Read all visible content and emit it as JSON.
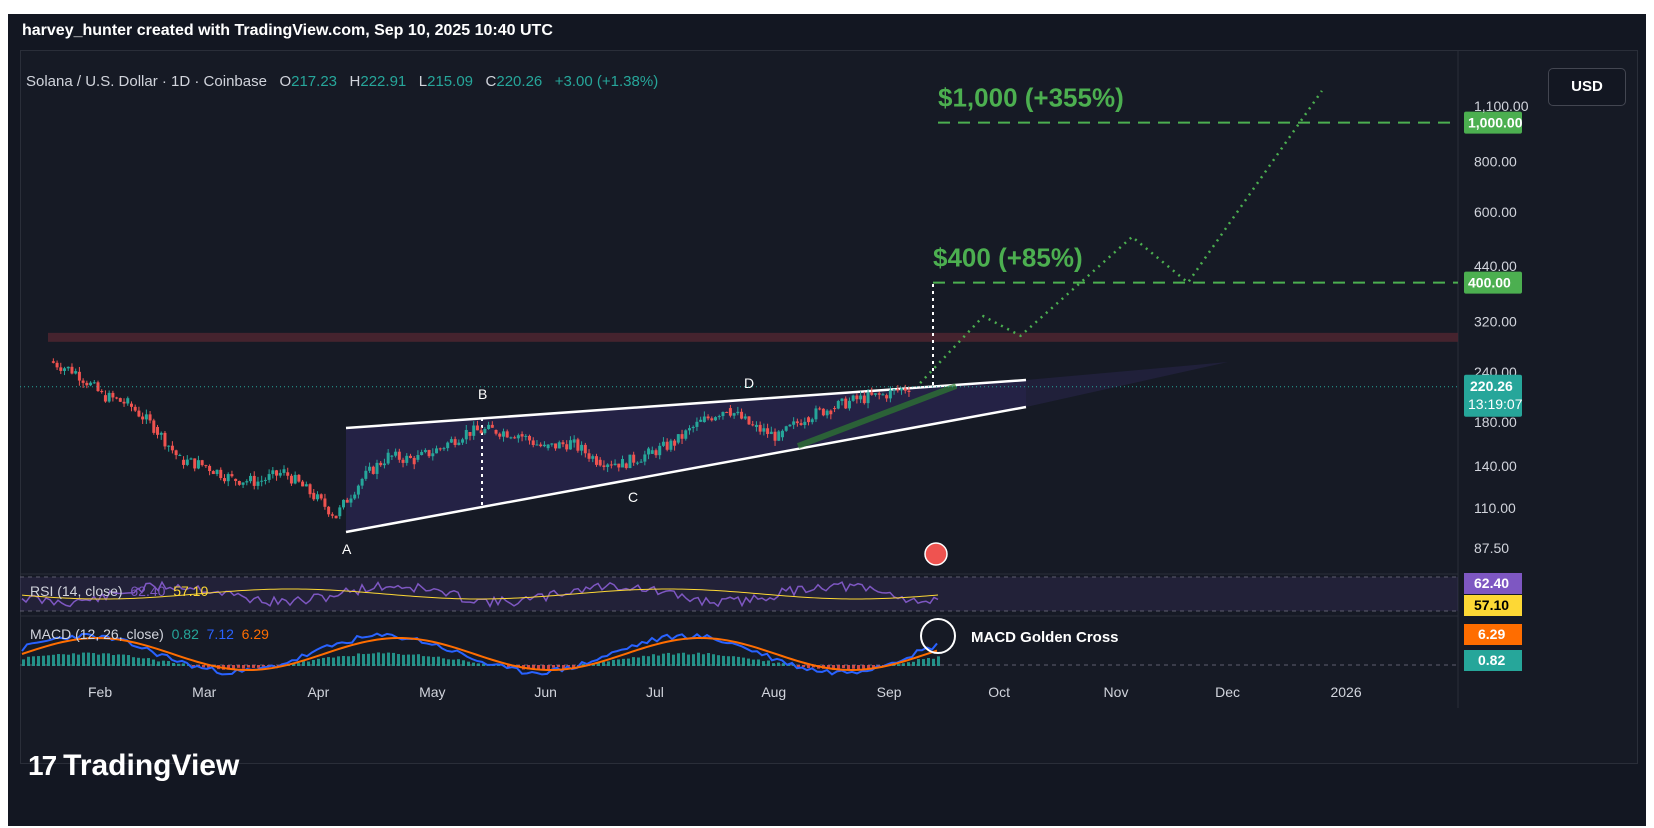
{
  "header": {
    "credit": "harvey_hunter created with TradingView.com, Sep 10, 2025 10:40 UTC"
  },
  "legend": {
    "symbol": "Solana / U.S. Dollar · 1D · Coinbase",
    "open_label": "O",
    "open": "217.23",
    "high_label": "H",
    "high": "222.91",
    "low_label": "L",
    "low": "215.09",
    "close_label": "C",
    "close": "220.26",
    "change": "+3.00 (+1.38%)"
  },
  "currency_button": "USD",
  "footer": {
    "logo_mark": "17",
    "brand": "TradingView"
  },
  "colors": {
    "up": "#26a69a",
    "down": "#ef5350",
    "target": "#4caf50",
    "pattern_fill": "#2a2550",
    "rsi": "#7e57c2",
    "macd": "#2962ff",
    "signal": "#ff6d00"
  },
  "chart_data": [
    {
      "type": "candlestick",
      "title": "Solana / U.S. Dollar · 1D · Coinbase",
      "scale": "log",
      "price_axis_ticks": [
        "1,100.00",
        "800.00",
        "600.00",
        "440.00",
        "320.00",
        "240.00",
        "180.00",
        "140.00",
        "110.00",
        "87.50"
      ],
      "price_axis_values": [
        1100,
        800,
        600,
        440,
        320,
        240,
        180,
        140,
        110,
        87.5
      ],
      "time_axis_ticks": [
        "Feb",
        "Mar",
        "Apr",
        "May",
        "Jun",
        "Jul",
        "Aug",
        "Sep",
        "Oct",
        "Nov",
        "Dec",
        "2026"
      ],
      "last_price_badge": {
        "price": "220.26",
        "countdown": "13:19:07"
      },
      "price_series": {
        "dates": [
          "Jan 20",
          "Jan 27",
          "Feb 03",
          "Feb 10",
          "Feb 17",
          "Feb 24",
          "Mar 03",
          "Mar 10",
          "Mar 17",
          "Mar 24",
          "Mar 31",
          "Apr 07",
          "Apr 14",
          "Apr 21",
          "Apr 28",
          "May 05",
          "May 12",
          "May 19",
          "May 26",
          "Jun 02",
          "Jun 09",
          "Jun 16",
          "Jun 23",
          "Jun 30",
          "Jul 07",
          "Jul 14",
          "Jul 21",
          "Jul 28",
          "Aug 04",
          "Aug 11",
          "Aug 18",
          "Aug 25",
          "Sep 01",
          "Sep 08"
        ],
        "close": [
          255,
          240,
          210,
          200,
          175,
          145,
          140,
          130,
          128,
          135,
          120,
          105,
          130,
          148,
          145,
          155,
          170,
          172,
          168,
          155,
          160,
          145,
          142,
          150,
          160,
          180,
          195,
          175,
          165,
          185,
          195,
          205,
          210,
          220
        ]
      },
      "pattern": {
        "name": "rising wedge",
        "points": [
          "A",
          "B",
          "C",
          "D"
        ]
      },
      "resistance_zone": [
        285,
        300
      ],
      "targets": [
        {
          "label": "$400 (+85%)",
          "price": 400,
          "badge": "400.00"
        },
        {
          "label": "$1,000 (+355%)",
          "price": 1000,
          "badge": "1,000.00"
        }
      ],
      "projection_path": [
        [
          "Sep 10",
          225
        ],
        [
          "Sep 27",
          330
        ],
        [
          "Oct 07",
          295
        ],
        [
          "Nov 06",
          520
        ],
        [
          "Nov 21",
          400
        ],
        [
          "Dec 27",
          1200
        ]
      ]
    },
    {
      "type": "line",
      "title": "RSI (14, close)",
      "series": [
        {
          "name": "RSI",
          "last": 62.4
        },
        {
          "name": "RSI-based MA",
          "last": 57.1
        }
      ],
      "values_label": [
        "62.40",
        "57.10"
      ]
    },
    {
      "type": "bar",
      "title": "MACD (12, 26, close)",
      "series": [
        {
          "name": "Histogram",
          "last": 0.82
        },
        {
          "name": "MACD",
          "last": 7.12
        },
        {
          "name": "Signal",
          "last": 6.29
        }
      ],
      "values_label": [
        "0.82",
        "7.12",
        "6.29"
      ],
      "annotation": "MACD Golden Cross"
    }
  ]
}
